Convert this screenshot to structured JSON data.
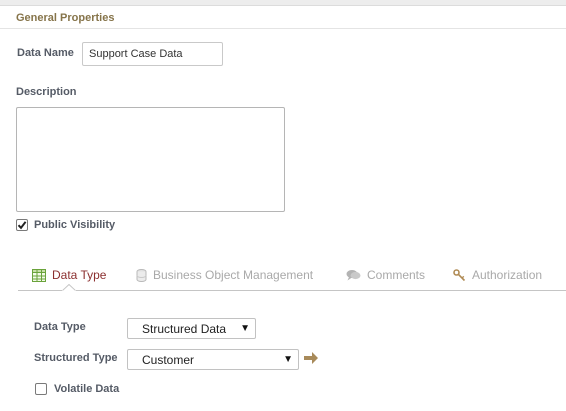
{
  "general": {
    "title": "General Properties",
    "data_name_label": "Data Name",
    "data_name_value": "Support Case Data",
    "description_label": "Description",
    "description_value": "",
    "public_visibility_label": "Public Visibility",
    "public_visibility_checked": true
  },
  "tabs": [
    {
      "label": "Data Type",
      "icon": "table-icon",
      "active": true
    },
    {
      "label": "Business Object Management",
      "icon": "database-icon",
      "active": false
    },
    {
      "label": "Comments",
      "icon": "speech-bubble-icon",
      "active": false
    },
    {
      "label": "Authorization",
      "icon": "key-icon",
      "active": false
    }
  ],
  "data_type_panel": {
    "data_type_label": "Data Type",
    "data_type_value": "Structured Data",
    "structured_type_label": "Structured Type",
    "structured_type_value": "Customer",
    "volatile_label": "Volatile Data",
    "volatile_checked": false
  },
  "colors": {
    "section_title": "#86744a",
    "active_tab": "#8b2f2f",
    "inactive_tab": "#a9a9a9",
    "arrow": "#a88a5a"
  }
}
